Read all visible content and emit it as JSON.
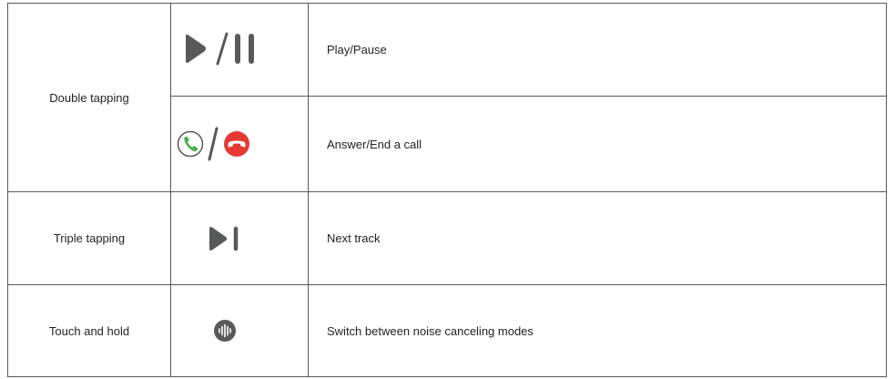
{
  "rows": [
    {
      "gesture": "Double tapping",
      "actions": [
        {
          "icon": "play-pause-icon",
          "label": "Play/Pause"
        },
        {
          "icon": "answer-end-call-icon",
          "label": "Answer/End a call"
        }
      ]
    },
    {
      "gesture": "Triple tapping",
      "actions": [
        {
          "icon": "next-track-icon",
          "label": "Next track"
        }
      ]
    },
    {
      "gesture": "Touch and hold",
      "actions": [
        {
          "icon": "noise-canceling-icon",
          "label": "Switch between noise canceling modes"
        }
      ]
    }
  ],
  "colors": {
    "border": "#58595b",
    "icon_dark": "#58595b",
    "answer_green": "#4caf50",
    "end_red": "#e53935",
    "text": "#231f20"
  }
}
